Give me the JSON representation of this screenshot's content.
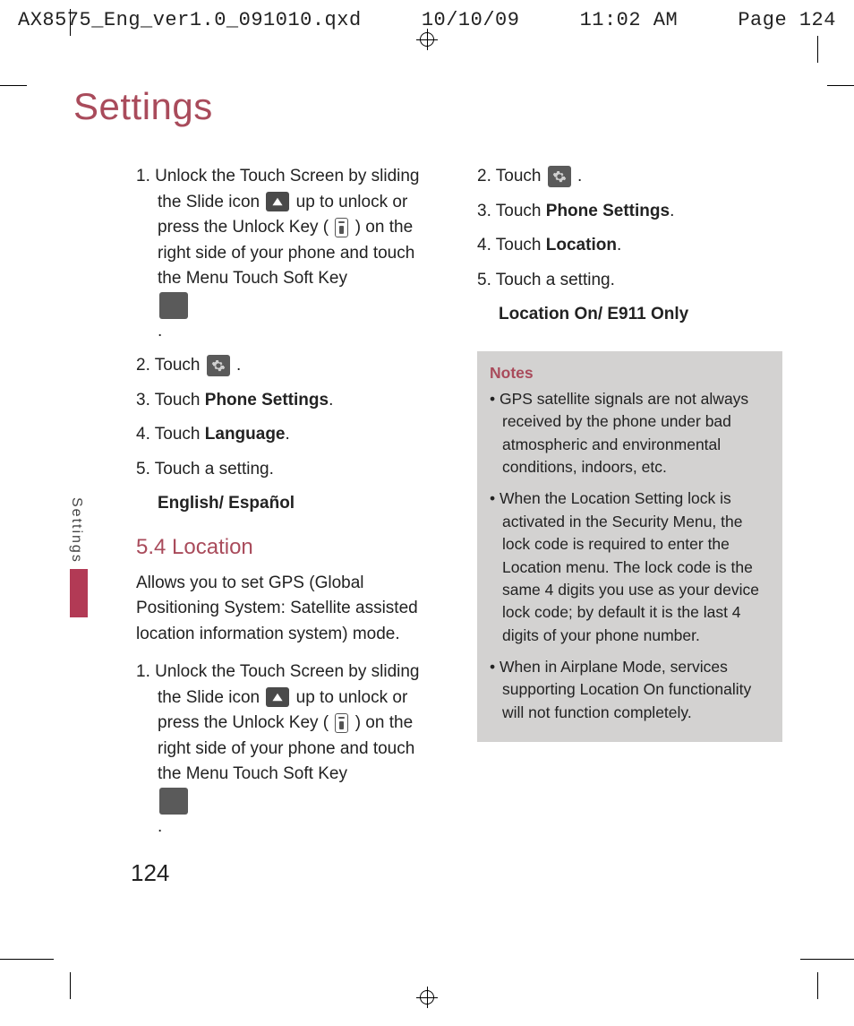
{
  "header": {
    "filename": "AX8575_Eng_ver1.0_091010.qxd",
    "date": "10/10/09",
    "time": "11:02 AM",
    "pageref": "Page 124"
  },
  "title": "Settings",
  "side_label": "Settings",
  "page_number": "124",
  "left": {
    "step1_a": "1. Unlock the Touch Screen by sliding the Slide icon ",
    "step1_b": " up to unlock or press the Unlock Key ( ",
    "step1_c": " ) on the right side of your phone and touch the Menu Touch Soft Key ",
    "step1_d": " .",
    "step2": "2. Touch ",
    "step2_end": " .",
    "step3_a": "3. Touch ",
    "step3_b": "Phone Settings",
    "step3_c": ".",
    "step4_a": "4. Touch ",
    "step4_b": "Language",
    "step4_c": ".",
    "step5": "5. Touch a setting.",
    "lang_options": "English/ Español",
    "section_5_4": "5.4 Location",
    "loc_desc": "Allows you to set GPS (Global Positioning System: Satellite assisted location information system) mode.",
    "loc_step1_a": "1. Unlock the Touch Screen by sliding the Slide icon ",
    "loc_step1_b": " up to unlock or press the Unlock Key ( ",
    "loc_step1_c": " ) on the right side of your phone and touch the Menu Touch Soft Key ",
    "loc_step1_d": " ."
  },
  "right": {
    "step2": "2. Touch ",
    "step2_end": " .",
    "step3_a": "3. Touch ",
    "step3_b": "Phone Settings",
    "step3_c": ".",
    "step4_a": "4. Touch ",
    "step4_b": "Location",
    "step4_c": ".",
    "step5": "5. Touch a setting.",
    "loc_options": "Location On/ E911 Only",
    "notes_title": "Notes",
    "note1": "• GPS satellite signals are not always received by the phone under bad atmospheric and environmental conditions, indoors, etc.",
    "note2": "• When the Location Setting lock is activated in the Security Menu, the lock code is required to enter the Location menu. The lock code is the same 4 digits you use as your device lock code; by default it is the last 4 digits of your phone number.",
    "note3": "• When in Airplane Mode, services supporting Location On functionality will not function completely."
  }
}
